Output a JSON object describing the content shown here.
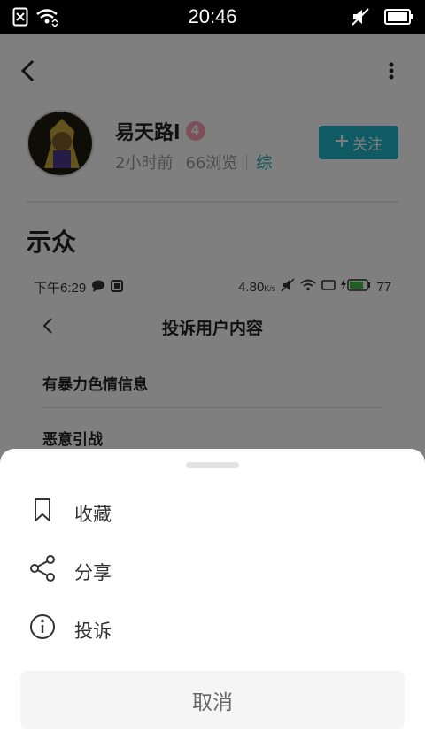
{
  "status_bar": {
    "time": "20:46",
    "icons": [
      "no-sim-icon",
      "wifi-icon",
      "mute-icon",
      "battery-icon"
    ]
  },
  "profile": {
    "username": "易天路l",
    "level": "4",
    "time_ago": "2小时前",
    "views": "66浏览",
    "category": "综",
    "follow_label": "关注"
  },
  "post": {
    "title": "示众"
  },
  "embedded_screenshot": {
    "status_time": "下午6:29",
    "status_speed": "4.80",
    "status_speed_unit": "K/s",
    "battery": "77",
    "title": "投诉用户内容",
    "items": [
      "有暴力色情信息",
      "恶意引战"
    ]
  },
  "sheet": {
    "actions": [
      {
        "label": "收藏",
        "icon": "bookmark-icon"
      },
      {
        "label": "分享",
        "icon": "share-icon"
      },
      {
        "label": "投诉",
        "icon": "info-icon"
      }
    ],
    "cancel_label": "取消"
  },
  "colors": {
    "accent": "#21b5c6",
    "badge": "#f6a0b8",
    "overlay": "rgba(0,0,0,0.5)"
  }
}
